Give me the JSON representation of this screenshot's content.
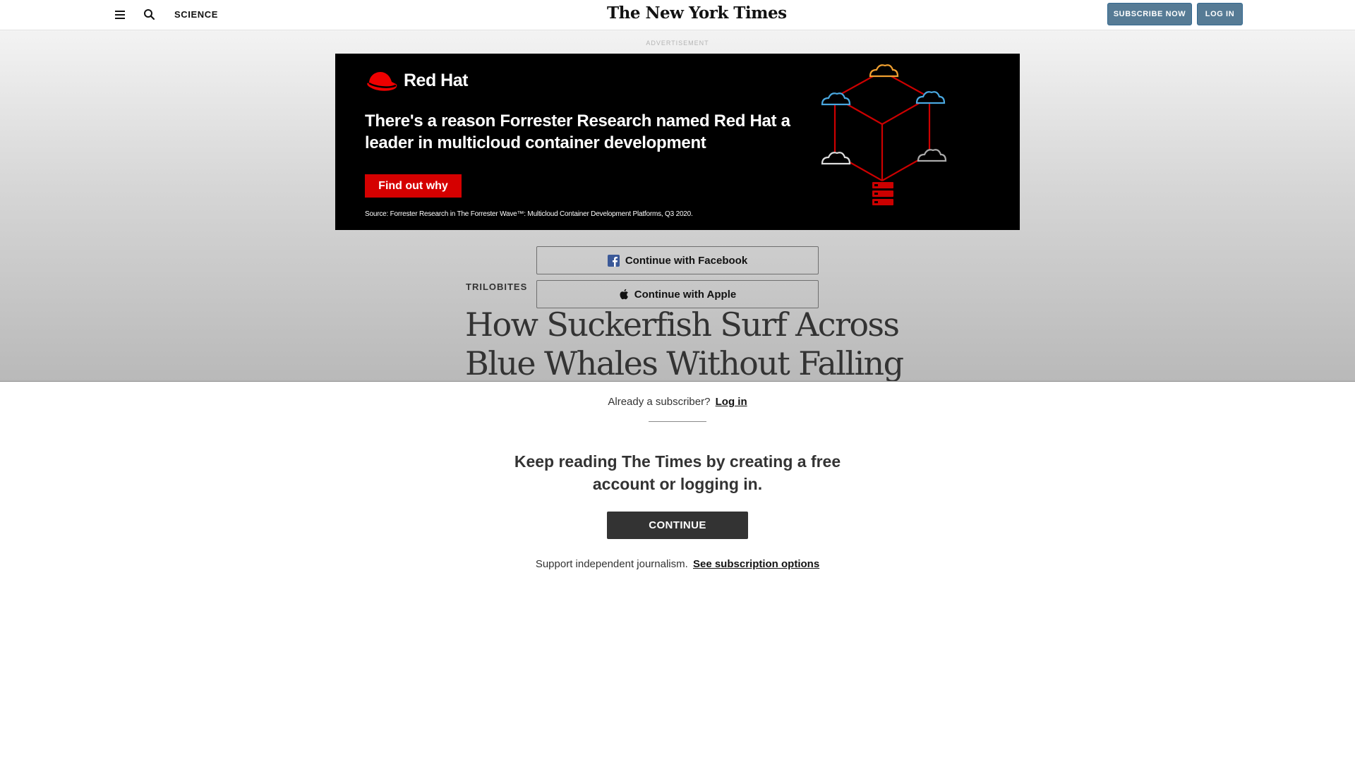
{
  "header": {
    "section": "SCIENCE",
    "logo_text": "The New York Times",
    "subscribe_label": "SUBSCRIBE NOW",
    "login_label": "LOG IN"
  },
  "ad": {
    "label": "ADVERTISEMENT",
    "brand": "Red Hat",
    "headline": "There's a reason Forrester Research named Red Hat a leader in multicloud container development",
    "cta": "Find out why",
    "source": "Source: Forrester Research in The Forrester Wave™: Multicloud Container Development Platforms, Q3 2020.",
    "colors": {
      "background": "#000000",
      "accent": "#d50000"
    }
  },
  "article": {
    "kicker": "TRILOBITES",
    "headline": "How Suckerfish Surf Across Blue Whales Without Falling Off"
  },
  "social_login": {
    "facebook_label": "Continue with Facebook",
    "apple_label": "Continue with Apple",
    "facebook_icon": "facebook-icon",
    "apple_icon": "apple-icon"
  },
  "paywall": {
    "already_text": "Already a subscriber?",
    "login_link": "Log in",
    "prompt": "Keep reading The Times by creating a free account or logging in.",
    "continue_label": "CONTINUE",
    "support_text": "Support independent journalism.",
    "subscription_link": "See subscription options"
  },
  "icons": {
    "menu": "hamburger-menu-icon",
    "search": "search-icon"
  },
  "colors": {
    "subscribe_button": "#567b95",
    "continue_button": "#333333"
  }
}
